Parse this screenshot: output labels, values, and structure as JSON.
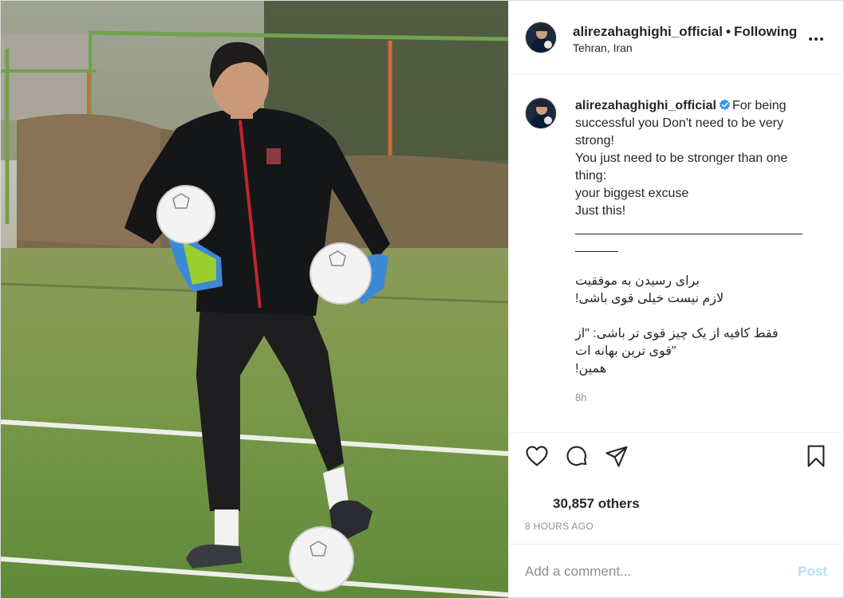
{
  "header": {
    "username": "alirezahaghighi_official",
    "separator": "•",
    "follow_state": "Following",
    "location": "Tehran, Iran"
  },
  "caption": {
    "username": "alirezahaghighi_official",
    "verified": true,
    "first_line": "For being",
    "lines": [
      "successful you Don't need to be very",
      "strong!",
      "You just need to be stronger than one",
      "thing:",
      "your biggest excuse",
      "Just this!",
      "________________________________",
      "______"
    ],
    "farsi_lines": [
      "برای رسیدن به موفقیت",
      "لازم نیست خیلی قوی باشی!",
      "",
      "فقط کافیه از یک چیز قوی تر باشی: \"از",
      "\"قوی ترین بهانه ات",
      "همین!"
    ],
    "time": "8h"
  },
  "actions": {
    "likes_text": "30,857 others",
    "time_ago": "8 HOURS AGO"
  },
  "comment": {
    "placeholder": "Add a comment...",
    "post_label": "Post"
  },
  "colors": {
    "verified": "#3897f0",
    "post_button_disabled": "#b2dffc",
    "muted_text": "#8e8e8e"
  },
  "icons": [
    "more-options-icon",
    "verified-badge-icon",
    "heart-icon",
    "comment-icon",
    "share-icon",
    "bookmark-icon"
  ]
}
